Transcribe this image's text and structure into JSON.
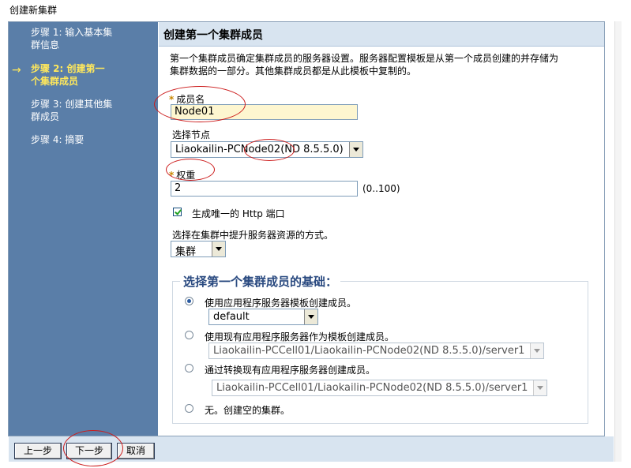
{
  "window": {
    "title": "创建新集群"
  },
  "steps": [
    {
      "label": "步骤 1: 输入基本集群信息",
      "current": false
    },
    {
      "label": "步骤 2: 创建第一个集群成员",
      "current": true
    },
    {
      "label": "步骤 3: 创建其他集群成员",
      "current": false
    },
    {
      "label": "步骤 4: 摘要",
      "current": false
    }
  ],
  "steps_display": {
    "s1_l1": "步骤 1: 输入基本集",
    "s1_l2": "群信息",
    "s2_l1": "步骤 2: 创建第一",
    "s2_l2": "个集群成员",
    "s3_l1": "步骤 3: 创建其他集",
    "s3_l2": "群成员",
    "s4_l1": "步骤 4: 摘要"
  },
  "current_step_marker": "→",
  "section": {
    "title": "创建第一个集群成员",
    "description_l1": "第一个集群成员确定集群成员的服务器设置。服务器配置模板是从第一个成员创建的并存储为",
    "description_l2": "集群数据的一部分。其他集群成员都是从此模板中复制的。"
  },
  "form": {
    "required_marker": "*",
    "member_name": {
      "label": "成员名",
      "value": "Node01"
    },
    "node": {
      "label": "选择节点",
      "value": "Liaokailin-PCNode02(ND 8.5.5.0)"
    },
    "weight": {
      "label": "权重",
      "value": "2",
      "range": "(0..100)"
    },
    "unique_http_port": {
      "label": "生成唯一的 Http 端口",
      "checked": true
    },
    "resource_method": {
      "label": "选择在集群中提升服务器资源的方式。",
      "value": "集群"
    }
  },
  "basis": {
    "legend": "选择第一个集群成员的基础：",
    "options": [
      {
        "label": "使用应用程序服务器模板创建成员。",
        "selected": true,
        "select_value": "default"
      },
      {
        "label": "使用现有应用程序服务器作为模板创建成员。",
        "selected": false,
        "select_value": "Liaokailin-PCCell01/Liaokailin-PCNode02(ND 8.5.5.0)/server1"
      },
      {
        "label": "通过转换现有应用程序服务器创建成员。",
        "selected": false,
        "select_value": "Liaokailin-PCCell01/Liaokailin-PCNode02(ND 8.5.5.0)/server1"
      },
      {
        "label": "无。创建空的集群。",
        "selected": false
      }
    ]
  },
  "buttons": {
    "previous": "上一步",
    "next": "下一步",
    "cancel": "取消"
  },
  "colors": {
    "sidebar": "#5a7ea8",
    "current_step": "#ffe85c",
    "header": "#d8e4f0",
    "annotation": "#cc1b1b"
  }
}
